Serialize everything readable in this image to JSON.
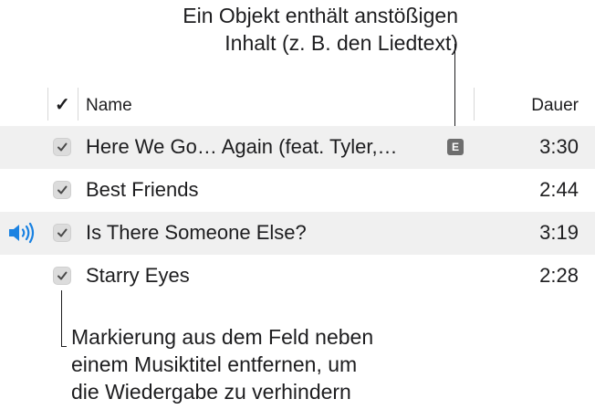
{
  "callouts": {
    "top_line1": "Ein Objekt enthält anstößigen",
    "top_line2": "Inhalt (z. B. den Liedtext)",
    "bottom_line1": "Markierung aus dem Feld neben",
    "bottom_line2": "einem Musiktitel entfernen, um",
    "bottom_line3": "die Wiedergabe zu verhindern"
  },
  "header": {
    "check": "✓",
    "name": "Name",
    "duration": "Dauer"
  },
  "tracks": [
    {
      "title": "Here We Go… Again (feat. Tyler,…",
      "duration": "3:30",
      "checked": true,
      "explicit": true,
      "playing": false
    },
    {
      "title": "Best Friends",
      "duration": "2:44",
      "checked": true,
      "explicit": false,
      "playing": false
    },
    {
      "title": "Is There Someone Else?",
      "duration": "3:19",
      "checked": true,
      "explicit": false,
      "playing": true
    },
    {
      "title": "Starry Eyes",
      "duration": "2:28",
      "checked": true,
      "explicit": false,
      "playing": false
    }
  ],
  "explicit_badge": "E",
  "icons": {
    "checkbox": "checkmark-icon",
    "playing": "speaker-icon",
    "explicit": "explicit-badge-icon"
  },
  "colors": {
    "speaker": "#1a82e2",
    "stripe": "#f0f0f0",
    "badge": "#6e6e6e"
  }
}
